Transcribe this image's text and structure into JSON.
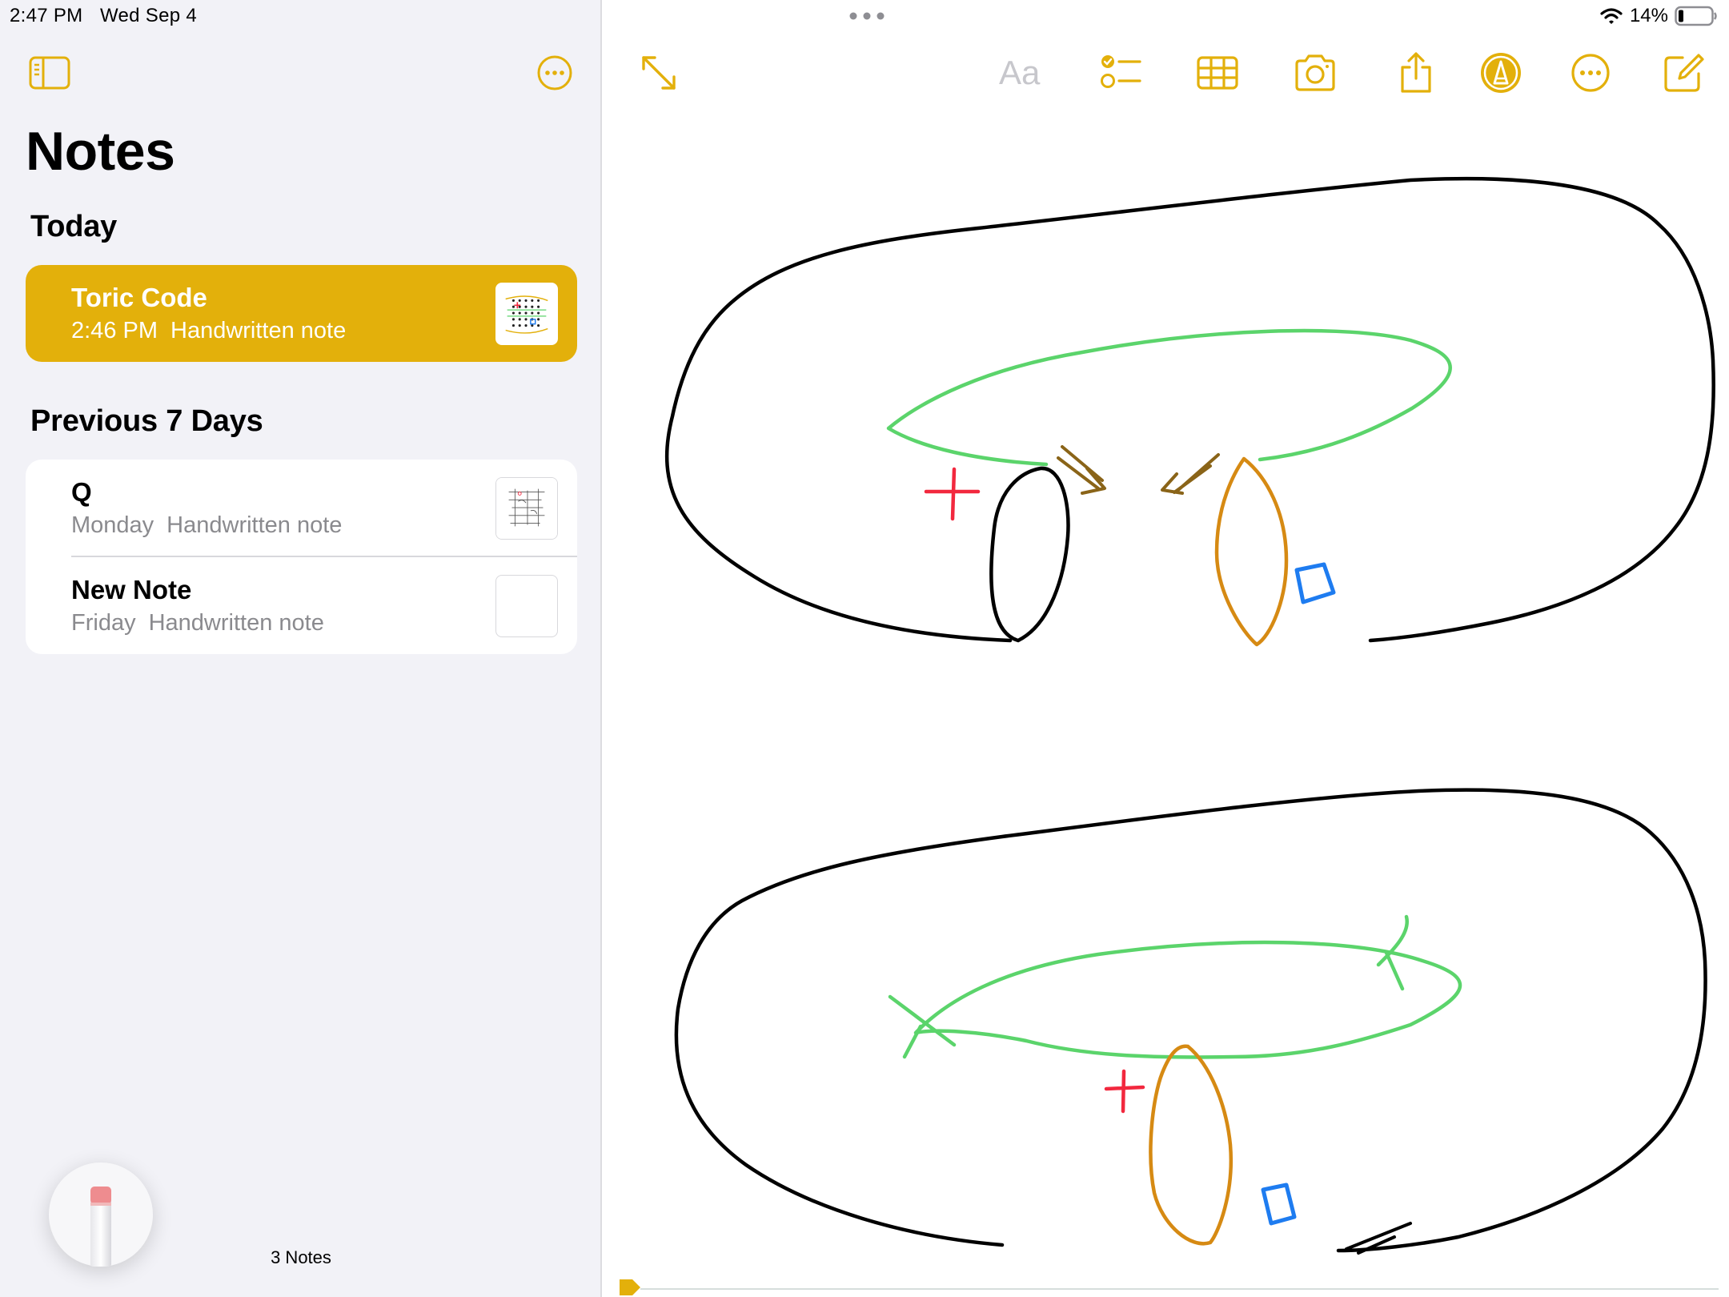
{
  "status_bar": {
    "time": "2:47 PM",
    "date": "Wed Sep 4",
    "battery_percent": "14%",
    "battery_level": 0.14,
    "icons": [
      "wifi-icon",
      "battery-icon"
    ]
  },
  "colors": {
    "accent": "#e3b00b",
    "sidebar_bg": "#f2f2f7",
    "secondary_text": "#8a8a8e",
    "ink_black": "#000000",
    "ink_green": "#5bd46b",
    "ink_orange": "#d68a13",
    "ink_brown": "#8a6418",
    "ink_red": "#f2283e",
    "ink_blue": "#1e7cf0"
  },
  "sidebar": {
    "title": "Notes",
    "toggle_icon": "sidebar-toggle-icon",
    "more_icon": "ellipsis-circle-icon",
    "sections": [
      {
        "heading": "Today",
        "notes": [
          {
            "title": "Toric Code",
            "time": "2:46 PM",
            "kind": "Handwritten note",
            "selected": true
          }
        ]
      },
      {
        "heading": "Previous 7 Days",
        "notes": [
          {
            "title": "Q",
            "time": "Monday",
            "kind": "Handwritten note",
            "selected": false
          },
          {
            "title": "New Note",
            "time": "Friday",
            "kind": "Handwritten note",
            "selected": false
          }
        ]
      }
    ],
    "notes_count": "3 Notes",
    "pencil_tool_icon": "eraser-tool-icon"
  },
  "editor": {
    "toolbar": {
      "expand_icon": "expand-arrows-icon",
      "format_label": "Aa",
      "icons": [
        "checklist-icon",
        "table-icon",
        "camera-icon",
        "share-icon",
        "markup-pen-icon",
        "ellipsis-circle-icon",
        "compose-icon"
      ]
    },
    "drawing": {
      "content": "handwritten sketch of two tori with green loops, orange loops, red plus marks, blue squares and brown arrows",
      "signs": {
        "plus": "+"
      }
    }
  }
}
